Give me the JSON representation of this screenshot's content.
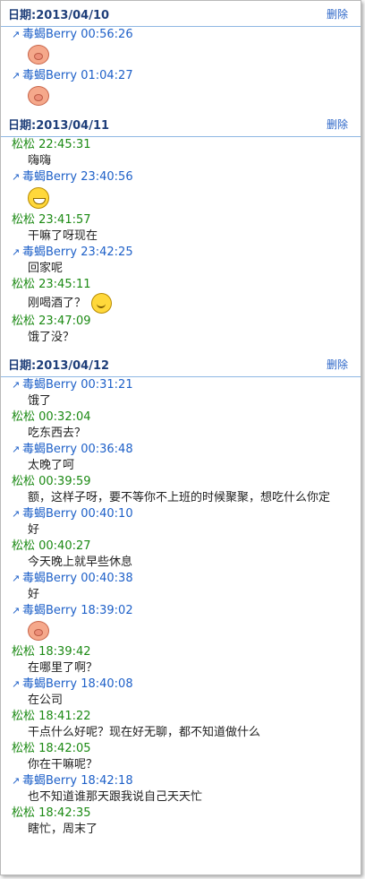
{
  "delete_label": "删除",
  "days": [
    {
      "date": "日期:2013/04/10",
      "messages": [
        {
          "from": "me",
          "sender": "毒蝎Berry 00:56:26",
          "emoji": "pig"
        },
        {
          "from": "me",
          "sender": "毒蝎Berry 01:04:27",
          "emoji": "pig"
        }
      ]
    },
    {
      "date": "日期:2013/04/11",
      "messages": [
        {
          "from": "other",
          "sender": "松松 22:45:31",
          "text": "嗨嗨"
        },
        {
          "from": "me",
          "sender": "毒蝎Berry 23:40:56",
          "emoji": "grin"
        },
        {
          "from": "other",
          "sender": "松松 23:41:57",
          "text": "干嘛了呀现在"
        },
        {
          "from": "me",
          "sender": "毒蝎Berry 23:42:25",
          "text": "回家呢"
        },
        {
          "from": "other",
          "sender": "松松 23:45:11",
          "text": "刚喝酒了？",
          "emoji": "smile"
        },
        {
          "from": "other",
          "sender": "松松 23:47:09",
          "text": "饿了没？"
        }
      ]
    },
    {
      "date": "日期:2013/04/12",
      "messages": [
        {
          "from": "me",
          "sender": "毒蝎Berry 00:31:21",
          "text": "饿了"
        },
        {
          "from": "other",
          "sender": "松松 00:32:04",
          "text": "吃东西去？"
        },
        {
          "from": "me",
          "sender": "毒蝎Berry 00:36:48",
          "text": "太晚了呵"
        },
        {
          "from": "other",
          "sender": "松松 00:39:59",
          "text": "额，这样子呀，要不等你不上班的时候聚聚，想吃什么你定"
        },
        {
          "from": "me",
          "sender": "毒蝎Berry 00:40:10",
          "text": "好"
        },
        {
          "from": "other",
          "sender": "松松 00:40:27",
          "text": "今天晚上就早些休息"
        },
        {
          "from": "me",
          "sender": "毒蝎Berry 00:40:38",
          "text": "好"
        },
        {
          "from": "me",
          "sender": "毒蝎Berry 18:39:02",
          "emoji": "pig"
        },
        {
          "from": "other",
          "sender": "松松 18:39:42",
          "text": "在哪里了啊？"
        },
        {
          "from": "me",
          "sender": "毒蝎Berry 18:40:08",
          "text": "在公司"
        },
        {
          "from": "other",
          "sender": "松松 18:41:22",
          "text": "干点什么好呢？现在好无聊，都不知道做什么"
        },
        {
          "from": "other",
          "sender": "松松 18:42:05",
          "text": "你在干嘛呢？"
        },
        {
          "from": "me",
          "sender": "毒蝎Berry 18:42:18",
          "text": "也不知道谁那天跟我说自己天天忙"
        },
        {
          "from": "other",
          "sender": "松松 18:42:35",
          "text": "瞎忙，周末了"
        }
      ]
    }
  ]
}
